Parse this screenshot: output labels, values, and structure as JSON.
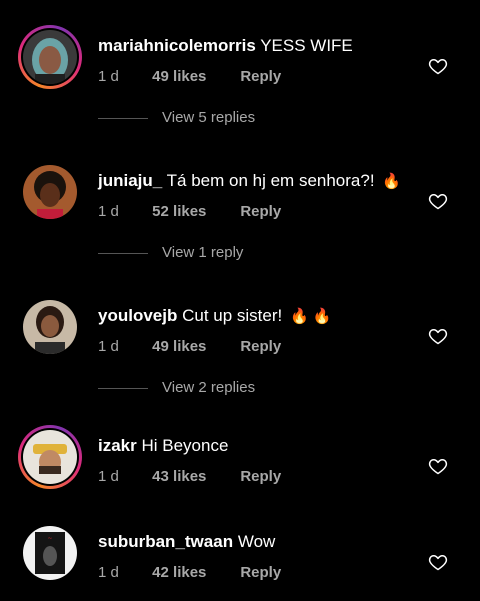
{
  "comments": [
    {
      "username": "mariahnicolemorris",
      "text": "YESS WIFE",
      "emoji": "",
      "time": "1 d",
      "likes": "49 likes",
      "reply_label": "Reply",
      "view_replies": "View 5 replies",
      "story_ring": true
    },
    {
      "username": "juniaju_",
      "text": "Tá bem on hj em senhora?!",
      "emoji": "🔥",
      "time": "1 d",
      "likes": "52 likes",
      "reply_label": "Reply",
      "view_replies": "View 1 reply",
      "story_ring": false
    },
    {
      "username": "youlovejb",
      "text": "Cut up sister!",
      "emoji": "🔥 🔥",
      "time": "1 d",
      "likes": "49 likes",
      "reply_label": "Reply",
      "view_replies": "View 2 replies",
      "story_ring": false
    },
    {
      "username": "izakr",
      "text": "Hi Beyonce",
      "emoji": "",
      "time": "1 d",
      "likes": "43 likes",
      "reply_label": "Reply",
      "story_ring": true
    },
    {
      "username": "suburban_twaan",
      "text": "Wow",
      "emoji": "",
      "time": "1 d",
      "likes": "42 likes",
      "reply_label": "Reply",
      "story_ring": false
    }
  ],
  "icons": {
    "like": "heart-outline-icon"
  },
  "colors": {
    "background": "#000000",
    "text": "#ffffff",
    "muted": "#a8a8a8"
  }
}
